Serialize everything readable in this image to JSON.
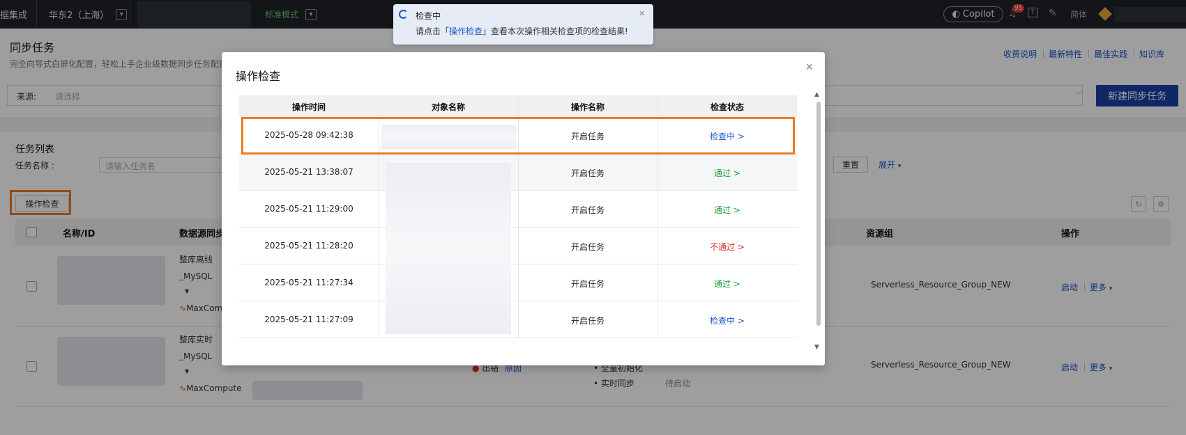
{
  "topbar": {
    "app_title": "据集成",
    "region": "华东2（上海）",
    "mode": "标准模式",
    "copilot": "Copilot",
    "notif_count": "95",
    "lang": "简体",
    "icons": [
      "copilot-icon",
      "bell-icon",
      "help-icon",
      "tools-icon",
      "diamond-icon"
    ]
  },
  "header": {
    "title": "同步任务",
    "desc": "完全向导式白屏化配置，轻松上手企业级数据同步任务配置",
    "links": [
      "收费说明",
      "最新特性",
      "最佳实践",
      "知识库"
    ],
    "source_label": "来源:",
    "source_placeholder": "请选择",
    "new_task": "新建同步任务"
  },
  "list": {
    "title": "任务列表",
    "filter_label": "任务名称 :",
    "filter_placeholder": "请输入任务名",
    "reset": "重置",
    "expand": "展开",
    "op_check": "操作检查",
    "columns": [
      "名称/ID",
      "数据源同步",
      "资源组",
      "操作"
    ],
    "rows": [
      {
        "sync_type": "整库离线",
        "src": "MySQL",
        "dst": "MaxCompu",
        "resource_group": "Serverless_Resource_Group_NEW",
        "action": "启动",
        "more": "更多"
      },
      {
        "sync_type": "整库实时",
        "src": "MySQL",
        "dst": "MaxCompute",
        "status": "出错",
        "reason": "原因",
        "stage1": "全量初始化",
        "stage2": "实时同步",
        "stage2_state": "待启动",
        "resource_group": "Serverless_Resource_Group_NEW",
        "action": "启动",
        "more": "更多"
      }
    ]
  },
  "toast": {
    "title": "检查中",
    "text_pre": "请点击「",
    "text_link": "操作检查",
    "text_post": "」查看本次操作相关检查项的检查结果!"
  },
  "modal": {
    "title": "操作检查",
    "columns": [
      "操作时间",
      "对象名称",
      "操作名称",
      "检查状态"
    ],
    "rows": [
      {
        "time": "2025-05-28 09:42:38",
        "op": "开启任务",
        "status": "检查中 >",
        "color": "#1b57c9"
      },
      {
        "time": "2025-05-21 13:38:07",
        "op": "开启任务",
        "status": "通过 >",
        "color": "#1a9c3e"
      },
      {
        "time": "2025-05-21 11:29:00",
        "op": "开启任务",
        "status": "通过 >",
        "color": "#1a9c3e"
      },
      {
        "time": "2025-05-21 11:28:20",
        "op": "开启任务",
        "status": "不通过 >",
        "color": "#e02a2a"
      },
      {
        "time": "2025-05-21 11:27:34",
        "op": "开启任务",
        "status": "通过 >",
        "color": "#1a9c3e"
      },
      {
        "time": "2025-05-21 11:27:09",
        "op": "开启任务",
        "status": "检查中 >",
        "color": "#1b57c9"
      }
    ]
  }
}
